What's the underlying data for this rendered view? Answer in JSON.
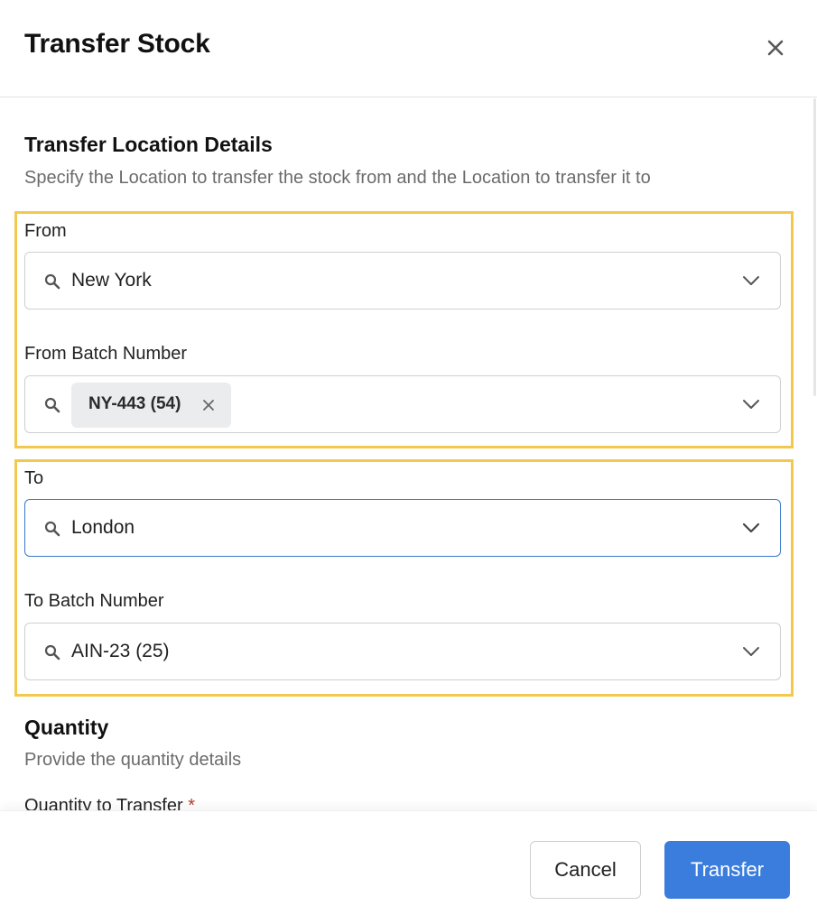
{
  "dialog": {
    "title": "Transfer Stock",
    "close_icon": "close-icon"
  },
  "location_section": {
    "title": "Transfer Location Details",
    "description": "Specify the Location to transfer the stock from and the Location to transfer it to"
  },
  "from": {
    "label": "From",
    "value": "New York",
    "batch_label": "From Batch Number",
    "batch_chip": "NY-443 (54)"
  },
  "to": {
    "label": "To",
    "value": "London",
    "batch_label": "To Batch Number",
    "batch_value": "AIN-23 (25)"
  },
  "quantity_section": {
    "title": "Quantity",
    "description": "Provide the quantity details",
    "field_label": "Quantity to Transfer",
    "required_mark": "*"
  },
  "footer": {
    "cancel_label": "Cancel",
    "primary_label": "Transfer"
  },
  "colors": {
    "highlight_border": "#f2c94c",
    "primary": "#3b7ddd",
    "focus_border": "#3a78c9"
  }
}
